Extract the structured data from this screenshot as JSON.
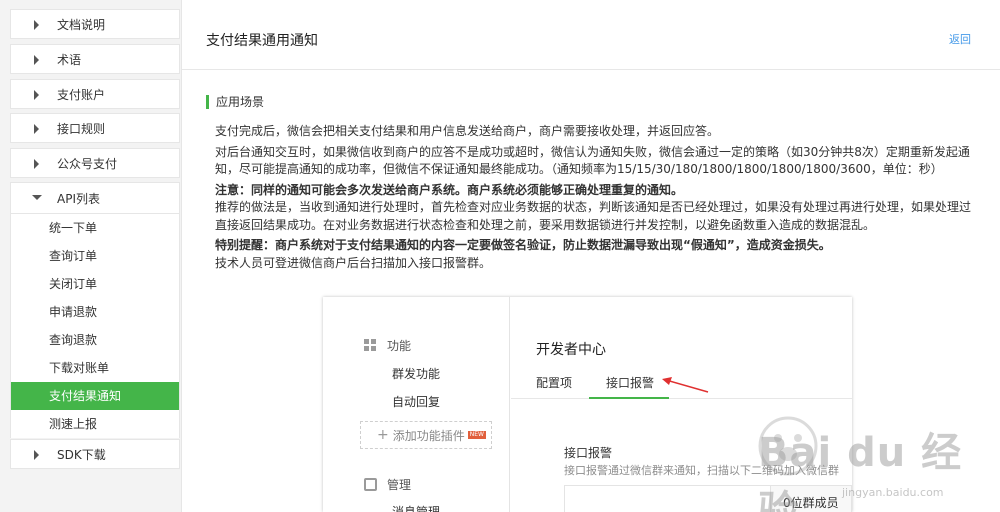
{
  "sidebar": {
    "top_items": [
      {
        "label": "文档说明"
      },
      {
        "label": "术语"
      },
      {
        "label": "支付账户"
      },
      {
        "label": "接口规则"
      },
      {
        "label": "公众号支付"
      },
      {
        "label": "API列表"
      }
    ],
    "sub_items": [
      {
        "label": "统一下单"
      },
      {
        "label": "查询订单"
      },
      {
        "label": "关闭订单"
      },
      {
        "label": "申请退款"
      },
      {
        "label": "查询退款"
      },
      {
        "label": "下载对账单"
      },
      {
        "label": "支付结果通知",
        "active": true
      },
      {
        "label": "测速上报"
      }
    ],
    "bottom_item": {
      "label": "SDK下载"
    }
  },
  "main": {
    "title": "支付结果通用通知",
    "back_label": "返回",
    "section_title": "应用场景",
    "paragraphs": [
      "支付完成后，微信会把相关支付结果和用户信息发送给商户，商户需要接收处理，并返回应答。",
      "对后台通知交互时，如果微信收到商户的应答不是成功或超时，微信认为通知失败，微信会通过一定的策略（如30分钟共8次）定期重新发起通知，尽可能提高通知的成功率，但微信不保证通知最终能成功。（通知频率为15/15/30/180/1800/1800/1800/1800/3600，单位：秒）",
      "注意：同样的通知可能会多次发送给商户系统。商户系统必须能够正确处理重复的通知。",
      "推荐的做法是，当收到通知进行处理时，首先检查对应业务数据的状态，判断该通知是否已经处理过，如果没有处理过再进行处理，如果处理过直接返回结果成功。在对业务数据进行状态检查和处理之前，要采用数据锁进行并发控制，以避免函数重入造成的数据混乱。",
      "特别提醒：商户系统对于支付结果通知的内容一定要做签名验证，防止数据泄漏导致出现“假通知”，造成资金损失。",
      "技术人员可登进微信商户后台扫描加入接口报警群。"
    ]
  },
  "screenshot": {
    "menu_group_1": "功能",
    "menu_items_1": [
      "群发功能",
      "自动回复"
    ],
    "add_plugin": "添加功能插件",
    "new_badge": "NEW",
    "menu_group_2": "管理",
    "menu_items_2": [
      "消息管理"
    ],
    "dev_center": "开发者中心",
    "tabs": [
      "配置项",
      "接口报警"
    ],
    "section_name": "接口报警",
    "section_desc": "接口报警通过微信群来通知，扫描以下二维码加入微信群",
    "members": "0位群成员"
  },
  "watermark": {
    "text": "Bai du 经验",
    "url": "jingyan.baidu.com"
  },
  "colors": {
    "accent": "#44b549",
    "link": "#459ae9",
    "arrow": "#e03030"
  }
}
